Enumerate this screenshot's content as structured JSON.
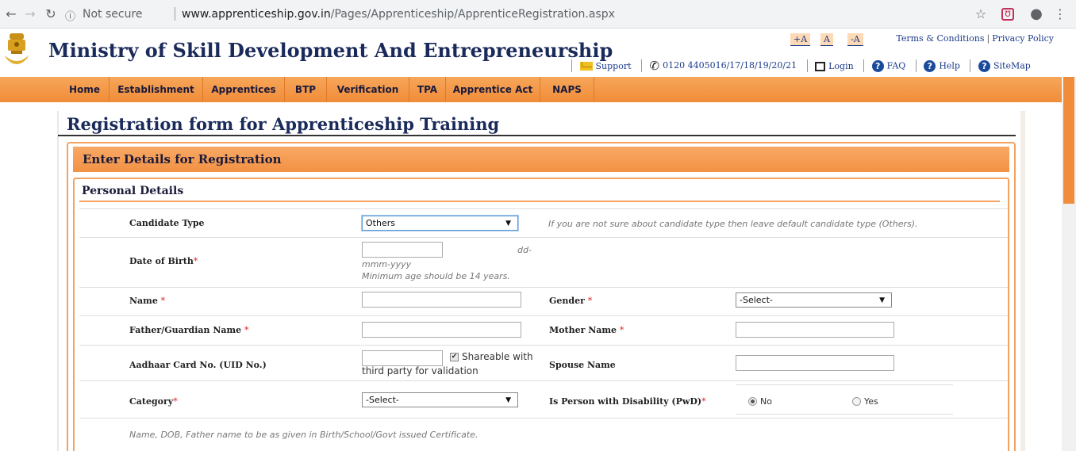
{
  "browser": {
    "secure_label": "Not secure",
    "url_host": "www.apprenticeship.gov.in",
    "url_path": "/Pages/Apprenticeship/ApprenticeRegistration.aspx"
  },
  "header": {
    "site_title": "Ministry of Skill Development And Entrepreneurship",
    "font_controls": [
      "+A",
      "A",
      "-A"
    ],
    "terms": "Terms & Conditions",
    "privacy": "Privacy Policy",
    "support": "Support",
    "phone": "0120 4405016/17/18/19/20/21",
    "login": "Login",
    "faq": "FAQ",
    "help": "Help",
    "sitemap": "SiteMap"
  },
  "menu": [
    "Home",
    "Establishment",
    "Apprentices",
    "BTP",
    "Verification",
    "TPA",
    "Apprentice Act",
    "NAPS"
  ],
  "page": {
    "title": "Registration form for Apprenticeship Training",
    "section_title": "Enter Details for Registration",
    "subsection_title": "Personal Details"
  },
  "form": {
    "candidate_type": {
      "label": "Candidate Type",
      "value": "Others",
      "note": "If you are not sure about candidate type then leave default candidate type (Others)."
    },
    "dob": {
      "label": "Date of Birth",
      "req": "*",
      "hint_a": "dd-",
      "hint_b": "mmm-yyyy",
      "hint_c": "Minimum age should be 14 years."
    },
    "name": {
      "label": "Name",
      "req": "*"
    },
    "gender": {
      "label": "Gender",
      "req": "*",
      "value": "-Select-"
    },
    "father": {
      "label": "Father/Guardian Name",
      "req": "*"
    },
    "mother": {
      "label": "Mother Name",
      "req": "*"
    },
    "aadhaar": {
      "label": "Aadhaar Card No. (UID No.)",
      "share_a": "Shareable with",
      "share_b": "third party for validation"
    },
    "spouse": {
      "label": "Spouse Name"
    },
    "category": {
      "label": "Category",
      "req": "*",
      "value": "-Select-"
    },
    "pwd": {
      "label": "Is Person with Disability (PwD)",
      "req": "*",
      "opt_no": "No",
      "opt_yes": "Yes"
    },
    "footer_note": "Name, DOB, Father name to be as given in Birth/School/Govt issued Certificate."
  },
  "colors": {
    "accent_orange": "#f08c3a",
    "title_navy": "#1a2a5a",
    "required_red": "#e02020"
  }
}
